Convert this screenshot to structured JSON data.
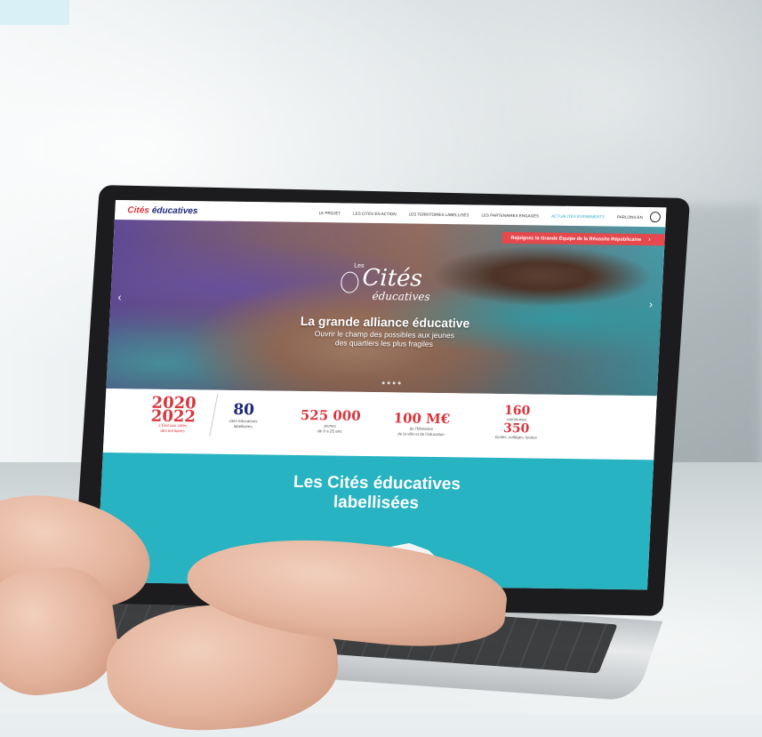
{
  "site": {
    "logo_part1": "Cités",
    "logo_part2": "éducatives",
    "nav": [
      "LE PROJET",
      "LES CITÉS EN ACTION",
      "LES TERRITOIRES LABELLISÉS",
      "LES PARTENAIRES ENGAGÉS",
      "ACTUALITÉS ÉVÉNEMENTS",
      "PARLONS-EN"
    ],
    "banner": "Rejoignez la Grande Équipe de la Réussite Républicaine"
  },
  "hero": {
    "logo_les": "Les",
    "logo_cites": "Cités",
    "logo_educatives": "éducatives",
    "title": "La grande alliance éducative",
    "subtitle_line1": "Ouvrir le champ des possibles aux jeunes",
    "subtitle_line2": "des quartiers les plus fragiles"
  },
  "stats": {
    "years_top": "2020",
    "years_bottom": "2022",
    "years_caption1": "L'État aux côtés",
    "years_caption2": "des territoires",
    "s2_value": "80",
    "s2_caption1": "cités éducatives",
    "s2_caption2": "labellisées",
    "s3_value": "525 000",
    "s3_caption1": "jeunes",
    "s3_caption2": "de 0 à 25 ans",
    "s4_value": "100 M€",
    "s4_caption1": "de l'Ministère",
    "s4_caption2": "de la ville et de l'éducation",
    "s5_value1": "160",
    "s5_caption1": "communes",
    "s5_value2": "350",
    "s5_caption2": "écoles, collèges, lycées"
  },
  "section": {
    "title_line1": "Les Cités éducatives",
    "title_line2": "labellisées"
  },
  "colors": {
    "red": "#d9363e",
    "navy": "#1e2a78",
    "teal": "#27b3c1"
  }
}
